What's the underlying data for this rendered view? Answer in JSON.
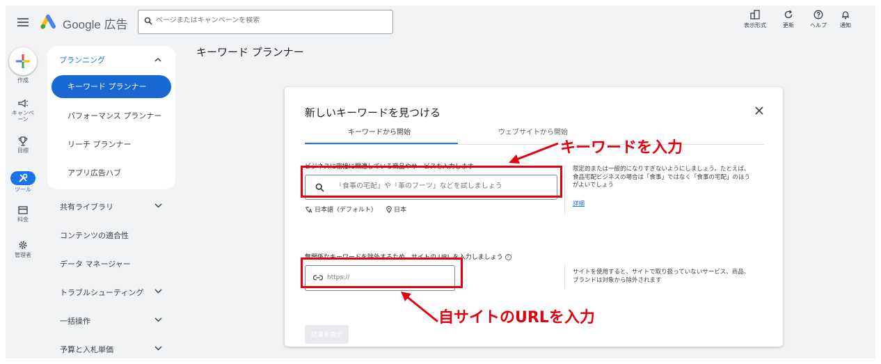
{
  "header": {
    "app_name": "Google 広告",
    "search_placeholder": "ページまたはキャンペーンを検索",
    "tools": [
      {
        "label": "表示形式",
        "icon": "display-format-icon"
      },
      {
        "label": "更新",
        "icon": "refresh-icon"
      },
      {
        "label": "ヘルプ",
        "icon": "help-icon"
      },
      {
        "label": "通知",
        "icon": "bell-icon"
      }
    ]
  },
  "rail": {
    "create": "作成",
    "campaign": "キャンペーン",
    "goals": "目標",
    "tools": "ツール",
    "billing": "料金",
    "admin": "管理者"
  },
  "nav": {
    "planning": "プランニング",
    "items": [
      "キーワード プランナー",
      "パフォーマンス プランナー",
      "リーチ プランナー",
      "アプリ広告ハブ"
    ],
    "sections": [
      "共有ライブラリ",
      "コンテンツの適合性",
      "データ マネージャー",
      "トラブルシューティング",
      "一括操作",
      "予算と入札単価"
    ]
  },
  "page_title": "キーワード プランナー",
  "dialog": {
    "title": "新しいキーワードを見つける",
    "tabs": [
      "キーワードから開始",
      "ウェブサイトから開始"
    ],
    "keyword_label": "ビジネスに密接に関連している商品やサービスを入力します",
    "keyword_placeholder": "「食事の宅配」や「革のブーツ」などを試しましょう",
    "language": "日本語（デフォルト）",
    "location": "日本",
    "keyword_hint": "限定的または一般的になりすぎないようにしましょう。たとえば、食品宅配ビジネスの場合は「食事」ではなく「食事の宅配」のほうがよいでしょう",
    "details_link": "詳細",
    "url_label": "無関係なキーワードを除外するため、サイトの URL を入力しましょう",
    "url_placeholder": "https://",
    "url_hint": "サイトを使用すると、サイトで取り扱っていないサービス、商品、ブランドは対象から除外されます",
    "show_results": "結果を表示"
  },
  "annotations": {
    "keyword": "キーワードを入力",
    "url": "自サイトのURLを入力",
    "color": "#e3000f"
  }
}
